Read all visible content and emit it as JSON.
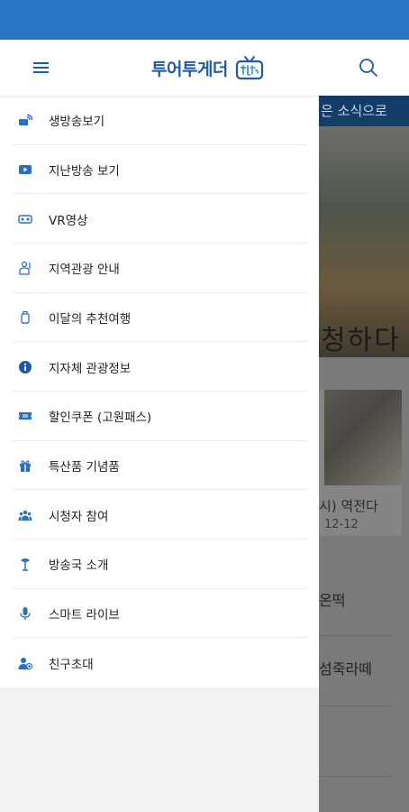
{
  "header": {
    "brand_title": "투어투게더",
    "menu_icon": "hamburger-menu-icon",
    "search_icon": "search-icon",
    "brand_color": "#1e5aa8",
    "status_bar_color": "#2a74c4"
  },
  "drawer": {
    "items": [
      {
        "label": "생방송보기",
        "icon": "live-broadcast-icon"
      },
      {
        "label": "지난방송 보기",
        "icon": "play-video-icon"
      },
      {
        "label": "VR영상",
        "icon": "vr-headset-icon"
      },
      {
        "label": "지역관광 안내",
        "icon": "tour-guide-icon"
      },
      {
        "label": "이달의 추천여행",
        "icon": "luggage-icon"
      },
      {
        "label": "지자체 관광정보",
        "icon": "info-icon"
      },
      {
        "label": "할인쿠폰 (고원패스)",
        "icon": "coupon-icon"
      },
      {
        "label": "특산품 기념품",
        "icon": "gift-icon"
      },
      {
        "label": "시청자 참여",
        "icon": "group-icon"
      },
      {
        "label": "방송국 소개",
        "icon": "antenna-icon"
      },
      {
        "label": "스마트 라이브",
        "icon": "microphone-icon"
      },
      {
        "label": "친구초대",
        "icon": "add-friend-icon"
      }
    ]
  },
  "background_page": {
    "ticker_text": "은 소식으로",
    "hero_caption": "청하다",
    "card_title": "시) 역전다",
    "card_date": "12-12",
    "list_item_1": "온떡",
    "list_item_2": "섬죽라떼"
  }
}
